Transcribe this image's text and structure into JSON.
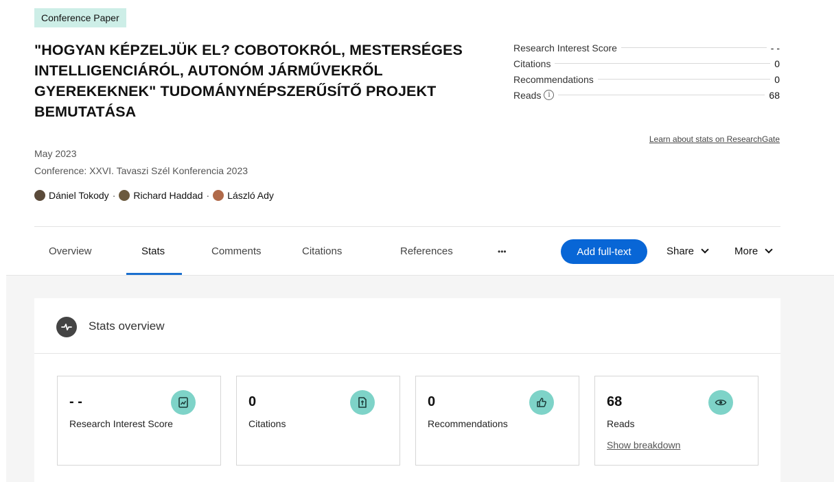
{
  "publication": {
    "type_badge": "Conference Paper",
    "title": "\"HOGYAN KÉPZELJÜK EL? COBOTOKRÓL, MESTERSÉGES INTELLIGENCIÁRÓL, AUTONÓM JÁRMŰVEKRŐL GYEREKEKNEK\" TUDOMÁNYNÉPSZERŰSÍTŐ PROJEKT BEMUTATÁSA",
    "date": "May 2023",
    "conference": "Conference: XXVI. Tavaszi Szél Konferencia 2023",
    "authors": [
      {
        "name": "Dániel Tokody",
        "avatar_color": "#5a4a3a"
      },
      {
        "name": "Richard Haddad",
        "avatar_color": "#6b5a3e"
      },
      {
        "name": "László Ady",
        "avatar_color": "#b06a4a"
      }
    ],
    "author_separator": "·"
  },
  "side_stats": {
    "rows": [
      {
        "label": "Research Interest Score",
        "value": "- -"
      },
      {
        "label": "Citations",
        "value": "0"
      },
      {
        "label": "Recommendations",
        "value": "0"
      },
      {
        "label": "Reads",
        "value": "68"
      }
    ],
    "info_glyph": "i",
    "learn_link": "Learn about stats on ResearchGate"
  },
  "tabs": {
    "items": [
      "Overview",
      "Stats",
      "Comments",
      "Citations",
      "References",
      "•••"
    ],
    "active": "Stats"
  },
  "actions": {
    "add_full_text": "Add full-text",
    "share": "Share",
    "more": "More"
  },
  "stats_overview": {
    "title": "Stats overview",
    "cards": [
      {
        "value": "- -",
        "label": "Research Interest Score",
        "icon": "research-interest-icon"
      },
      {
        "value": "0",
        "label": "Citations",
        "icon": "citation-icon"
      },
      {
        "value": "0",
        "label": "Recommendations",
        "icon": "thumbs-up-icon"
      },
      {
        "value": "68",
        "label": "Reads",
        "icon": "eye-icon",
        "link": "Show breakdown"
      }
    ]
  },
  "colors": {
    "accent_blue": "#0866d6",
    "badge_bg": "#cdeee7",
    "stat_icon_bg": "#7ed3c8"
  }
}
